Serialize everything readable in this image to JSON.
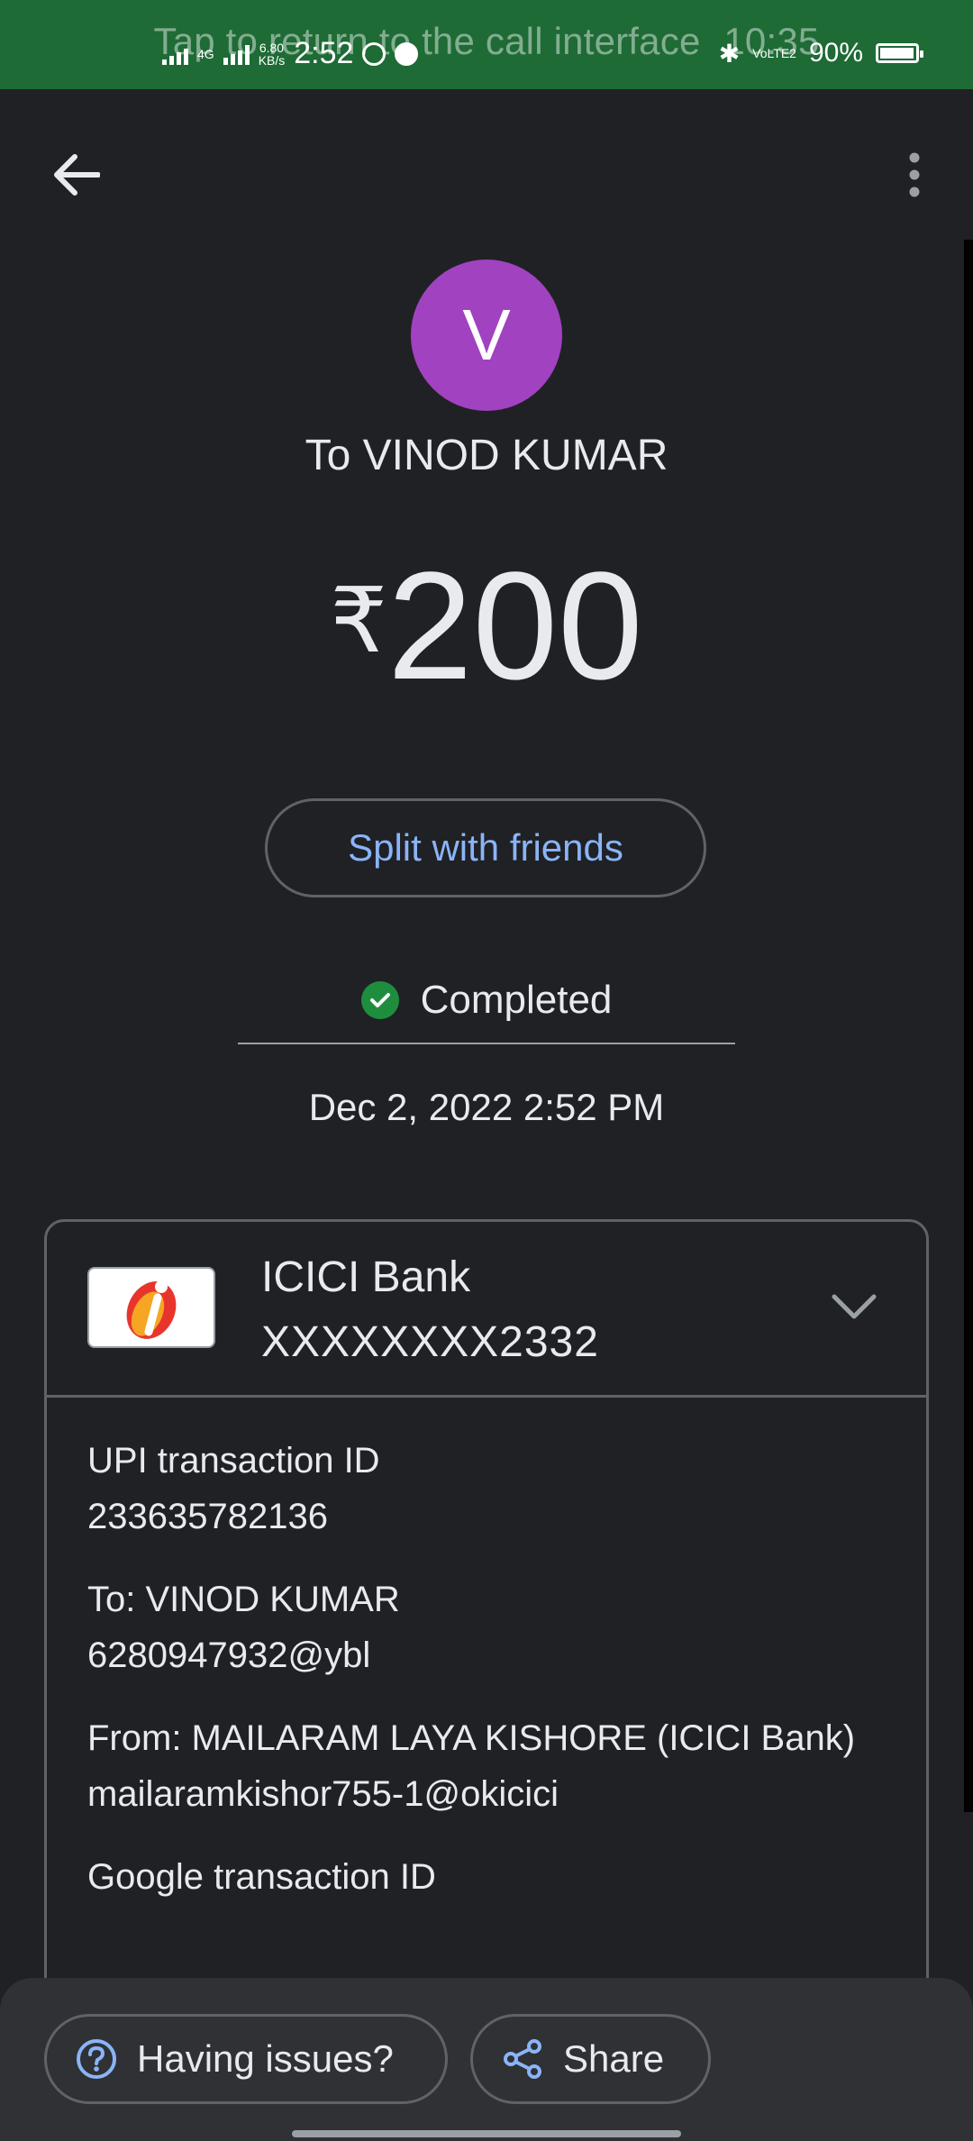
{
  "status_bar": {
    "call_hint": "Tap to return to the call interface",
    "call_time": "10:35",
    "network": "4G",
    "speed": "6.80",
    "speed_unit": "KB/s",
    "time": "2:52",
    "volte": "VoLTE2",
    "battery": "90%",
    "battery_level": 0.9
  },
  "payment": {
    "avatar_letter": "V",
    "recipient": "To VINOD KUMAR",
    "currency": "₹",
    "amount": "200",
    "split_label": "Split with friends",
    "status": "Completed",
    "datetime": "Dec 2, 2022 2:52 PM"
  },
  "bank": {
    "name": "ICICI Bank",
    "account": "XXXXXXXX2332"
  },
  "details": {
    "upi_label": "UPI transaction ID",
    "upi_value": "233635782136",
    "to_label": "To: VINOD KUMAR",
    "to_value": "6280947932@ybl",
    "from_label": "From: MAILARAM LAYA KISHORE (ICICI Bank)",
    "from_value": "mailaramkishor755-1@okicici",
    "google_label": "Google transaction ID"
  },
  "actions": {
    "issues_label": "Having issues?",
    "share_label": "Share"
  },
  "colors": {
    "background": "#202124",
    "status_bar": "#1e6b35",
    "avatar": "#a142c0",
    "link": "#8ab4f8",
    "success": "#1e8e3e"
  }
}
